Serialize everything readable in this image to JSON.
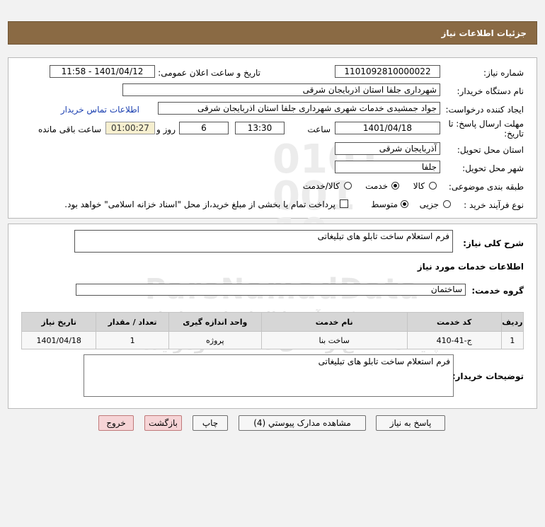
{
  "header": {
    "title": "جزئیات اطلاعات نیاز"
  },
  "form": {
    "need_number_label": "شماره نیاز:",
    "need_number": "1101092810000022",
    "announce_label": "تاریخ و ساعت اعلان عمومی:",
    "announce_value": "1401/04/12 - 11:58",
    "buyer_label": "نام دستگاه خریدار:",
    "buyer_value": "شهرداری جلفا استان اذربایجان شرقی",
    "requester_label": "ایجاد کننده درخواست:",
    "requester_value": "جواد جمشیدی  خدمات شهری شهرداری جلفا استان اذربایجان شرقی",
    "contact_link": "اطلاعات تماس خریدار",
    "deadline_label_1": "مهلت ارسال پاسخ: تا",
    "deadline_label_2": "تاریخ:",
    "deadline_date": "1401/04/18",
    "time_label": "ساعت",
    "deadline_time": "13:30",
    "days_value": "6",
    "days_label": "روز و",
    "remaining_time": "01:00:27",
    "remaining_label": "ساعت باقی مانده",
    "province_label": "استان محل تحویل:",
    "province_value": "آذربایجان شرقی",
    "city_label": "شهر محل تحویل:",
    "city_value": "جلفا",
    "category_label": "طبقه بندی موضوعی:",
    "category_options": [
      "کالا",
      "خدمت",
      "کالا/خدمت"
    ],
    "category_selected": "خدمت",
    "process_label": "نوع فرآیند خرید :",
    "process_options": [
      "جزیی",
      "متوسط"
    ],
    "process_selected": "متوسط",
    "payment_text": "پرداخت تمام یا بخشی از مبلغ خرید،از محل \"اسناد خزانه اسلامی\" خواهد بود."
  },
  "details": {
    "summary_label": "شرح کلی نیاز:",
    "summary_value": "فرم استعلام ساخت تابلو های تبلیغاتی",
    "services_title": "اطلاعات خدمات مورد نیاز",
    "service_group_label": "گروه خدمت:",
    "service_group_value": "ساختمان",
    "table": {
      "headers": [
        "ردیف",
        "کد خدمت",
        "نام خدمت",
        "واحد اندازه گیری",
        "تعداد / مقدار",
        "تاریخ نیاز"
      ],
      "rows": [
        [
          "1",
          "ج-41-410",
          "ساخت بنا",
          "پروژه",
          "1",
          "1401/04/18"
        ]
      ]
    },
    "buyer_notes_label": "توضیحات خریدار:",
    "buyer_notes_value": "فرم استعلام ساخت تابلو های تبلیغاتی"
  },
  "buttons": {
    "reply": "پاسخ به نیاز",
    "attachments": "مشاهده مدارک پیوستي (4)",
    "print": "چاپ",
    "back": "بازگشت",
    "exit": "خروج"
  },
  "watermark": {
    "line1": "ParsNamadData",
    "line2": "مرکز فرآوری اطلاعات پارس نماد داده",
    "line3": "پایگاه اطلاع رسانی مناقصه ومزایده",
    "line4": "۰۲۱-۸۸۳۴۹۶۷۰-۵"
  },
  "colors": {
    "header_bg": "#8a6a44",
    "link": "#1a3fb0",
    "timer_bg": "#f6efcf",
    "exit_btn": "#f6d4d6"
  }
}
